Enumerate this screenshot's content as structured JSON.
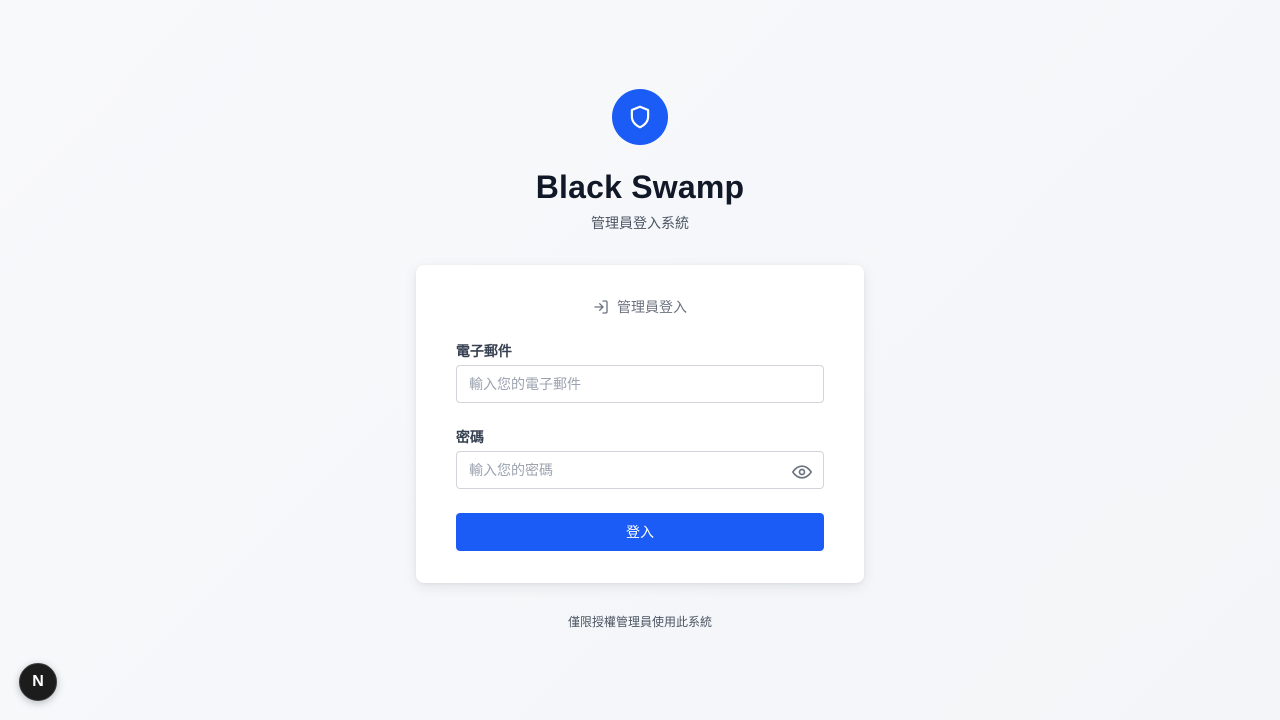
{
  "brand": {
    "title": "Black Swamp",
    "subtitle": "管理員登入系統",
    "logo_icon": "shield-icon",
    "accent_color": "#1a5cf5"
  },
  "login_card": {
    "header_icon": "login-arrow-icon",
    "header_label": "管理員登入",
    "email": {
      "label": "電子郵件",
      "value": "",
      "placeholder": "輸入您的電子郵件"
    },
    "password": {
      "label": "密碼",
      "value": "",
      "placeholder": "輸入您的密碼",
      "toggle_icon": "eye-icon"
    },
    "submit_label": "登入"
  },
  "footer": {
    "note": "僅限授權管理員使用此系統"
  },
  "dev_badge": {
    "label": "N"
  }
}
